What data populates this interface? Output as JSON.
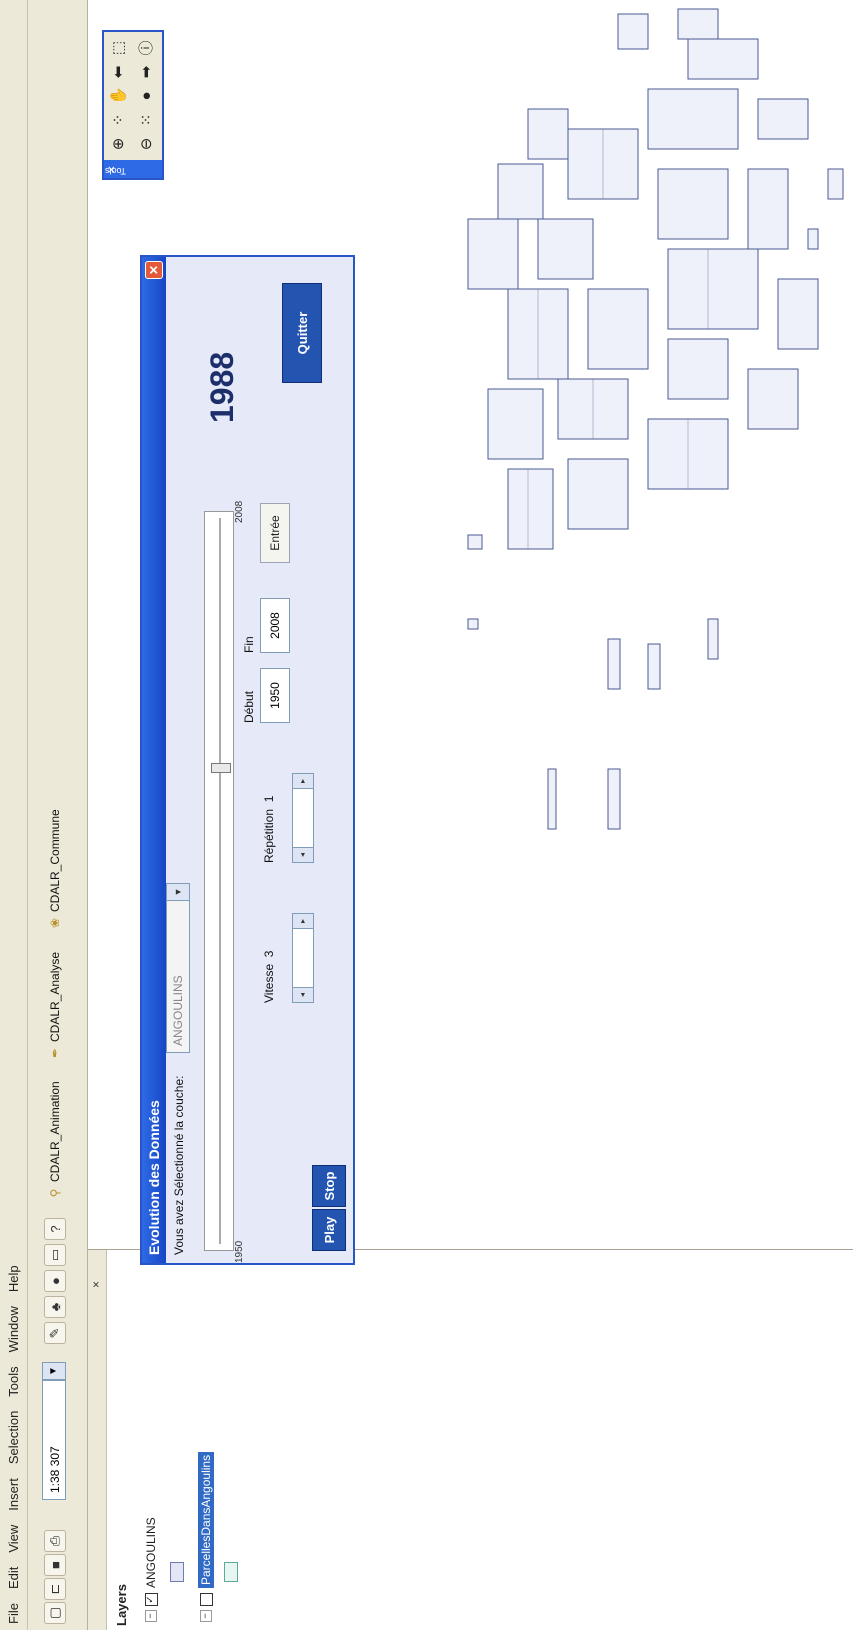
{
  "menu": [
    "File",
    "Edit",
    "View",
    "Insert",
    "Selection",
    "Tools",
    "Window",
    "Help"
  ],
  "toolbar": {
    "scale_value": "1:38 307",
    "extensions": [
      "CDALR_Animation",
      "CDALR_Analyse",
      "CDALR_Commune"
    ]
  },
  "toc": {
    "title": "Layers",
    "layers": [
      {
        "name": "ANGOULINS",
        "checked": true
      },
      {
        "name": "ParcellesDansAngoulins",
        "checked": false,
        "selected": true
      }
    ]
  },
  "dialog": {
    "title": "Evolution des Données",
    "layer_prompt": "Vous avez Sélectionné la couche:",
    "layer_value": "ANGOULINS",
    "slider_min": "1950",
    "slider_max": "2008",
    "slider_value_fraction": 0.655,
    "current_year": "1988",
    "vitesse_label": "Vitesse",
    "vitesse_value": "3",
    "repetition_label": "Répétition",
    "repetition_value": "1",
    "debut_label": "Début",
    "debut_value": "1950",
    "fin_label": "Fin",
    "fin_value": "2008",
    "entree_button": "Entrée",
    "play_button": "Play",
    "stop_button": "Stop",
    "quitter_button": "Quitter"
  },
  "tools_panel": {
    "title": "Tools"
  }
}
